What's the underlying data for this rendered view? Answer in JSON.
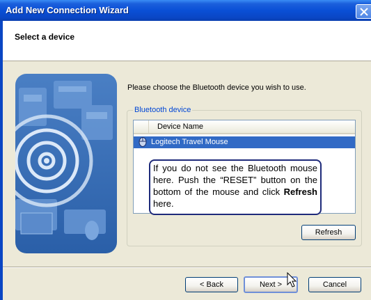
{
  "window": {
    "title": "Add New Connection Wizard"
  },
  "header": {
    "title": "Select a device"
  },
  "main": {
    "instruction": "Please choose the Bluetooth device you wish to use.",
    "group_label": "Bluetooth device",
    "list": {
      "column_header": "Device Name",
      "items": [
        {
          "label": "Logitech Travel Mouse",
          "icon": "mouse-icon",
          "selected": true
        }
      ]
    },
    "callout": {
      "text_before": "If you do not see the Bluetooth mouse here. Push the “RESET” button on the bottom of the mouse and click ",
      "bold": "Refresh",
      "text_after": " here."
    },
    "refresh_label": "Refresh"
  },
  "footer": {
    "back_label": "< Back",
    "next_label": "Next >",
    "cancel_label": "Cancel"
  },
  "colors": {
    "title_bar": "#0a4fd6",
    "selection": "#316ac5",
    "group_label": "#0046d5"
  }
}
